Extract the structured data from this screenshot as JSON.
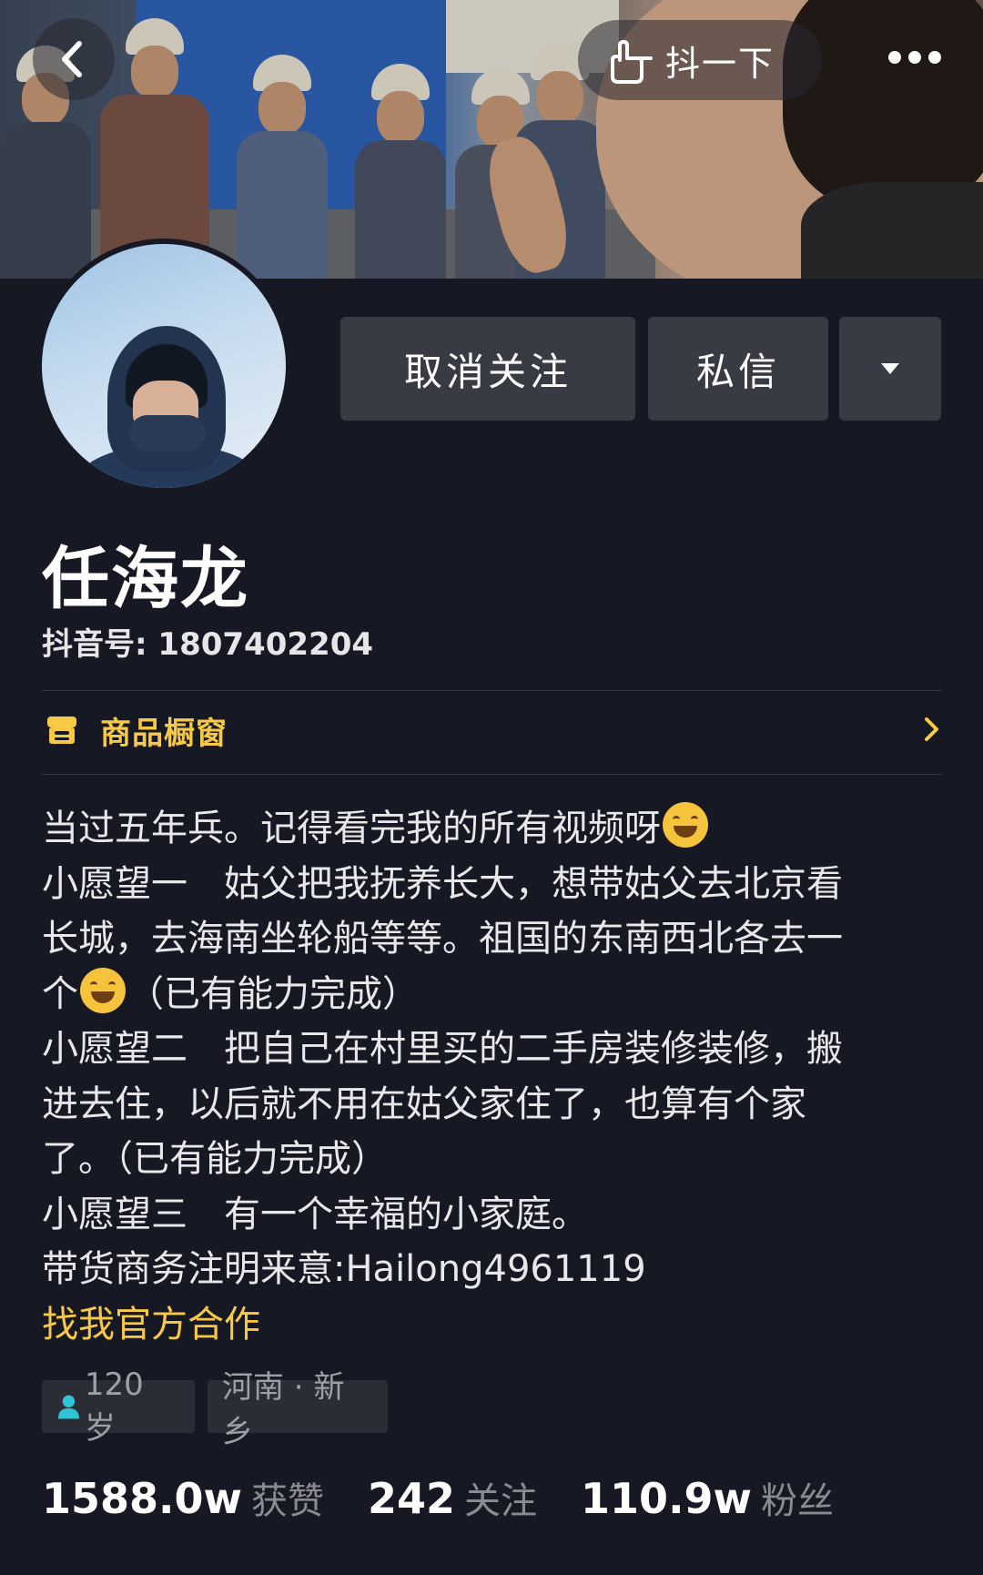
{
  "header": {
    "shake_label": "抖一下"
  },
  "profile": {
    "name": "任海龙",
    "douyin_id": "抖音号: 1807402204"
  },
  "actions": {
    "unfollow_label": "取消关注",
    "message_label": "私信"
  },
  "shop": {
    "label": "商品橱窗"
  },
  "bio": {
    "line1": "当过五年兵。记得看完我的所有视频呀",
    "line2": "小愿望一　姑父把我抚养长大，想带姑父去北京看",
    "line3": "长城，去海南坐轮船等等。祖国的东南西北各去一",
    "line4a": "个",
    "line4b": "（已有能力完成）",
    "line5": "小愿望二　把自己在村里买的二手房装修装修，搬",
    "line6": "进去住，以后就不用在姑父家住了，也算有个家",
    "line7": "了。（已有能力完成）",
    "line8": "小愿望三　有一个幸福的小家庭。",
    "line9": "带货商务注明来意:Hailong4961119",
    "link": "找我官方合作"
  },
  "tags": {
    "age": "120 岁",
    "location": "河南 · 新乡"
  },
  "stats": {
    "likes_num": "1588.0w",
    "likes_label": "获赞",
    "following_num": "242",
    "following_label": "关注",
    "followers_num": "110.9w",
    "followers_label": "粉丝"
  },
  "colors": {
    "background": "#161823",
    "accent_yellow": "#f8c945",
    "button_bg": "#393b44",
    "tag_bg": "#2b2d36",
    "person_icon": "#2ec4d6"
  },
  "icons": [
    "back-arrow-icon",
    "hand-pointer-icon",
    "more-dots-icon",
    "caret-down-icon",
    "shop-window-icon",
    "chevron-right-icon",
    "grinning-squint-emoji",
    "grinning-emoji",
    "person-icon"
  ]
}
